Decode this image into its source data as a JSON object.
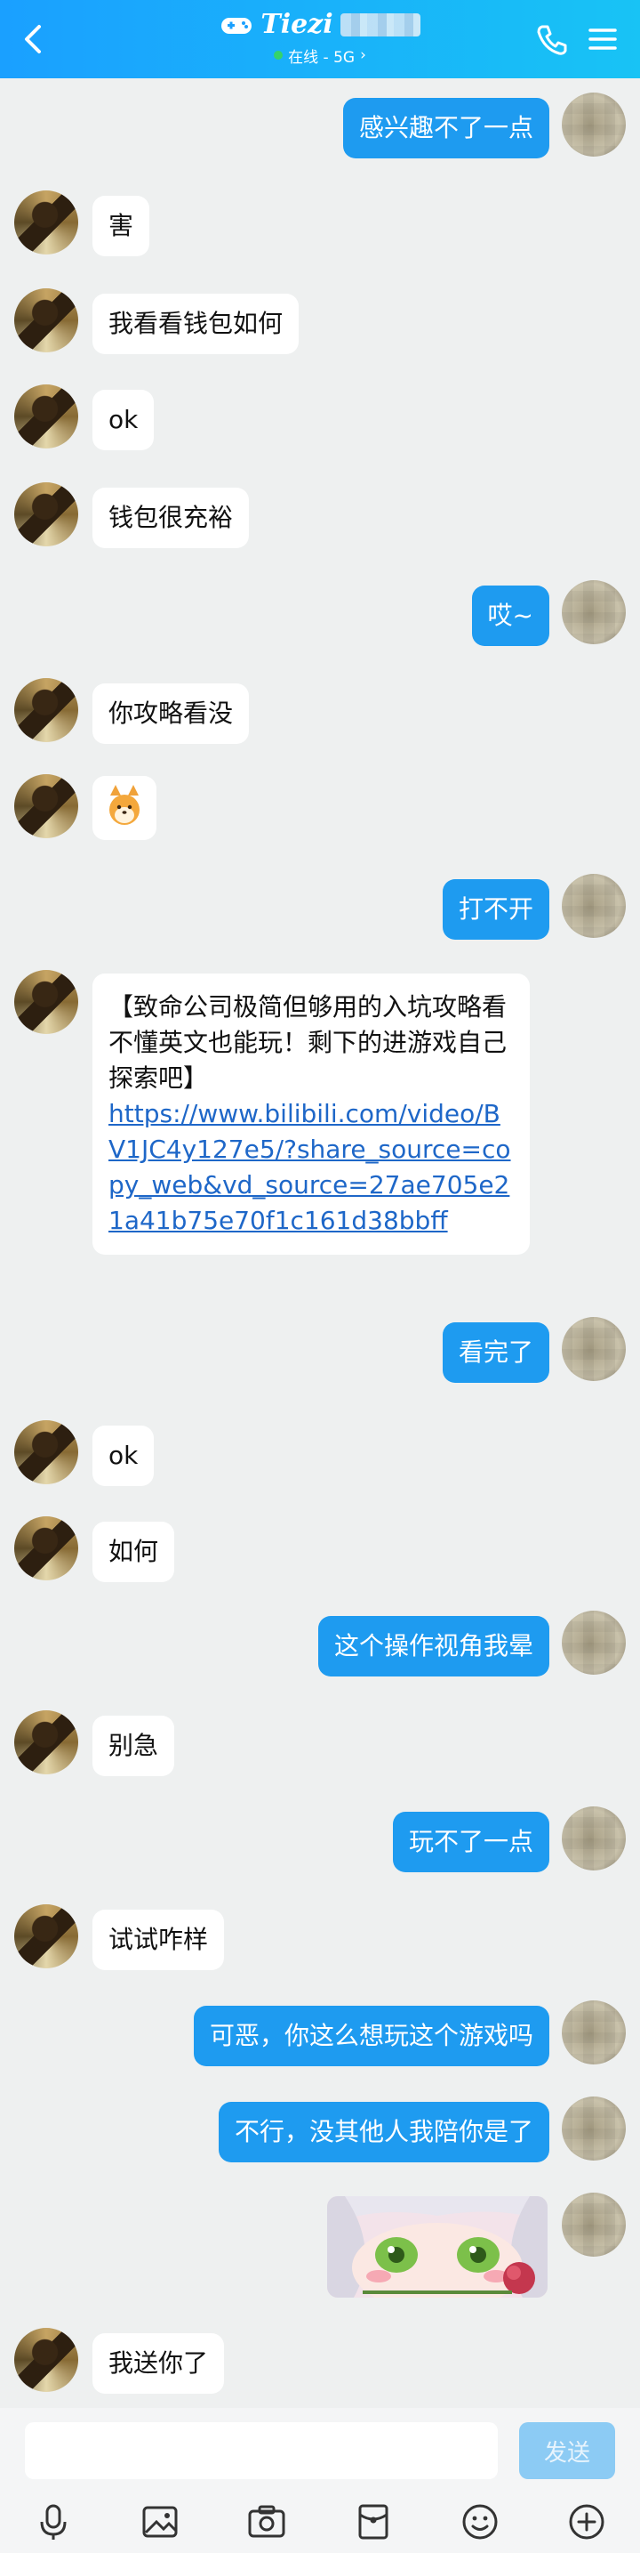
{
  "header": {
    "title_logo": "Tiezi",
    "status_text": "在线 - 5G",
    "status_chevron": "›",
    "icons": [
      "back-icon",
      "gamepad-icon",
      "phone-icon",
      "menu-icon"
    ]
  },
  "messages": [
    {
      "side": "right",
      "text": "感兴趣不了一点"
    },
    {
      "side": "left",
      "text": "害"
    },
    {
      "side": "left",
      "text": "我看看钱包如何"
    },
    {
      "side": "left",
      "text": "ok"
    },
    {
      "side": "left",
      "text": "钱包很充裕"
    },
    {
      "side": "right",
      "text": "哎~"
    },
    {
      "side": "left",
      "text": "你攻略看没"
    },
    {
      "side": "left",
      "type": "emoji",
      "emoji_name": "shiba-dog-emoji"
    },
    {
      "side": "right",
      "text": "打不开"
    },
    {
      "side": "left",
      "type": "link",
      "text": "【致命公司极简但够用的入坑攻略看不懂英文也能玩！剩下的进游戏自己探索吧】",
      "link": "https://www.bilibili.com/video/BV1JC4y127e5/?share_source=copy_web&vd_source=27ae705e21a41b75e70f1c161d38bbff"
    },
    {
      "side": "right",
      "text": "看完了"
    },
    {
      "side": "left",
      "text": "ok"
    },
    {
      "side": "left",
      "text": "如何"
    },
    {
      "side": "right",
      "text": "这个操作视角我晕"
    },
    {
      "side": "left",
      "text": "别急"
    },
    {
      "side": "right",
      "text": "玩不了一点"
    },
    {
      "side": "left",
      "text": "试试咋样"
    },
    {
      "side": "right",
      "text": "可恶，你这么想玩这个游戏吗"
    },
    {
      "side": "right",
      "text": "不行，没其他人我陪你是了"
    },
    {
      "side": "right",
      "type": "sticker",
      "sticker_name": "anime-girl-sticker"
    },
    {
      "side": "left",
      "text": "我送你了"
    }
  ],
  "input": {
    "placeholder": "",
    "value": "",
    "send_label": "发送"
  },
  "toolbar": {
    "icons": [
      "microphone-icon",
      "image-icon",
      "camera-icon",
      "red-packet-icon",
      "smiley-icon",
      "plus-icon"
    ]
  },
  "colors": {
    "header_start": "#1aa0ff",
    "header_end": "#18c3f5",
    "self_bubble": "#1e9bf0",
    "other_bubble": "#ffffff",
    "background": "#eef0f0",
    "link": "#1e67c8"
  }
}
